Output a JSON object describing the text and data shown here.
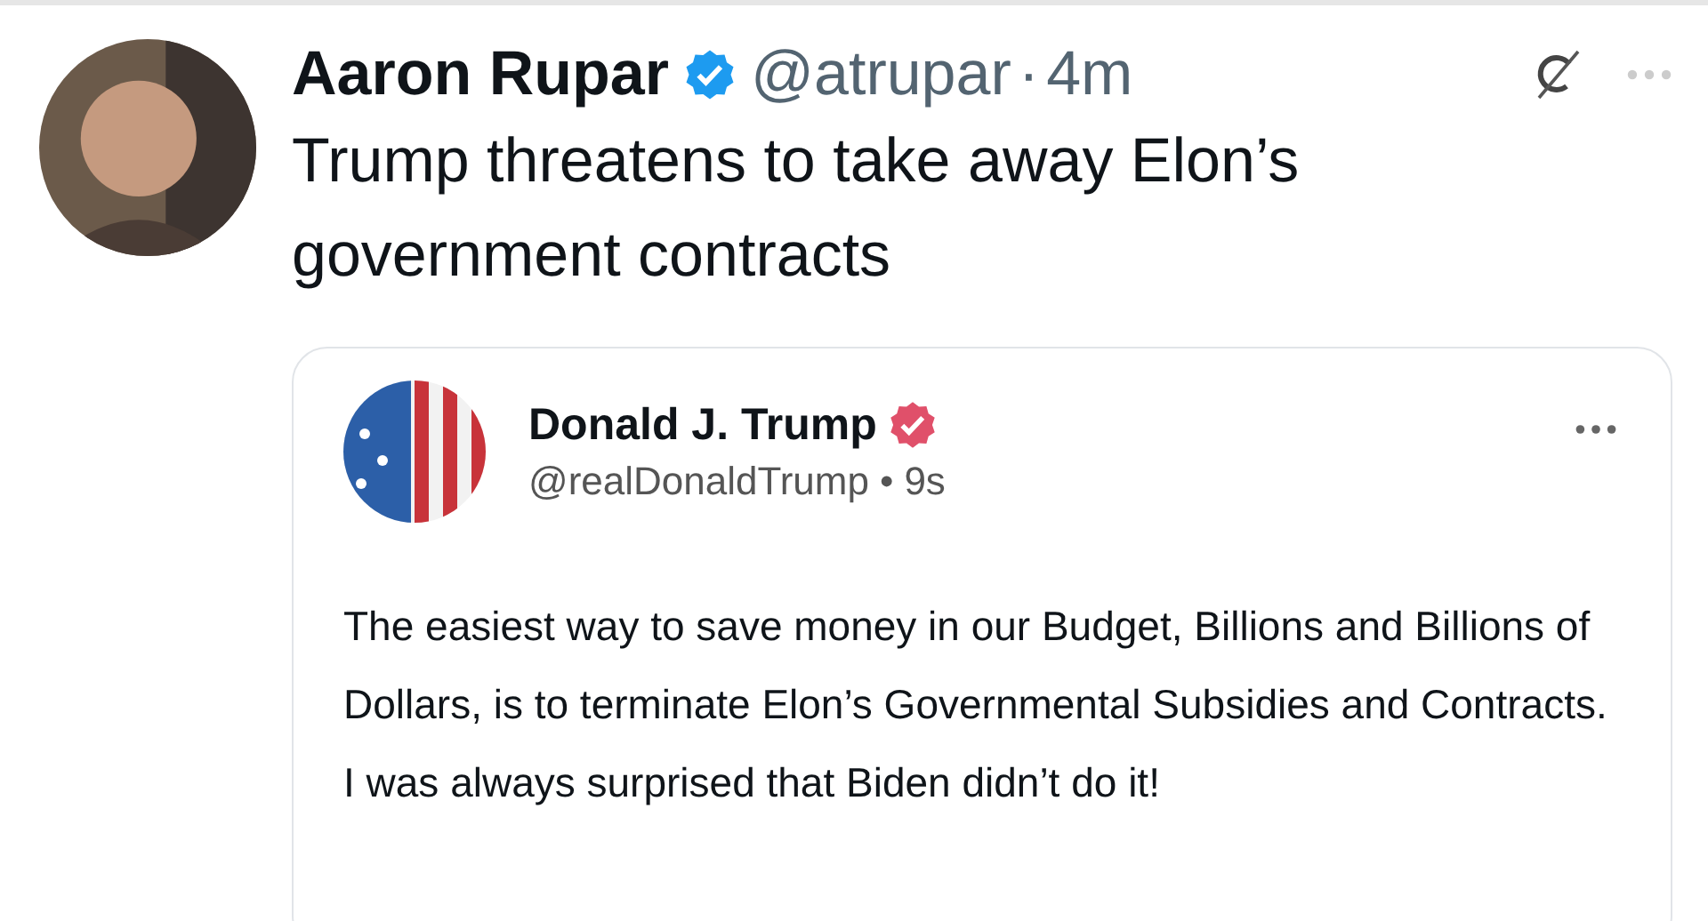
{
  "tweet": {
    "author": {
      "name": "Aaron Rupar",
      "verified": true,
      "handle": "@atrupar",
      "separator": "·",
      "time": "4m"
    },
    "text": "Trump threatens to take away Elon’s government contracts",
    "quoted_post": {
      "author": {
        "name": "Donald J. Trump",
        "verified": true,
        "handle": "@realDonaldTrump",
        "separator": "•",
        "time": "9s"
      },
      "text": "The easiest way to save money in our Budget, Billions and Billions of Dollars, is to terminate Elon’s Governmental Subsidies and Contracts. I was always surprised that Biden didn’t do it!"
    }
  }
}
